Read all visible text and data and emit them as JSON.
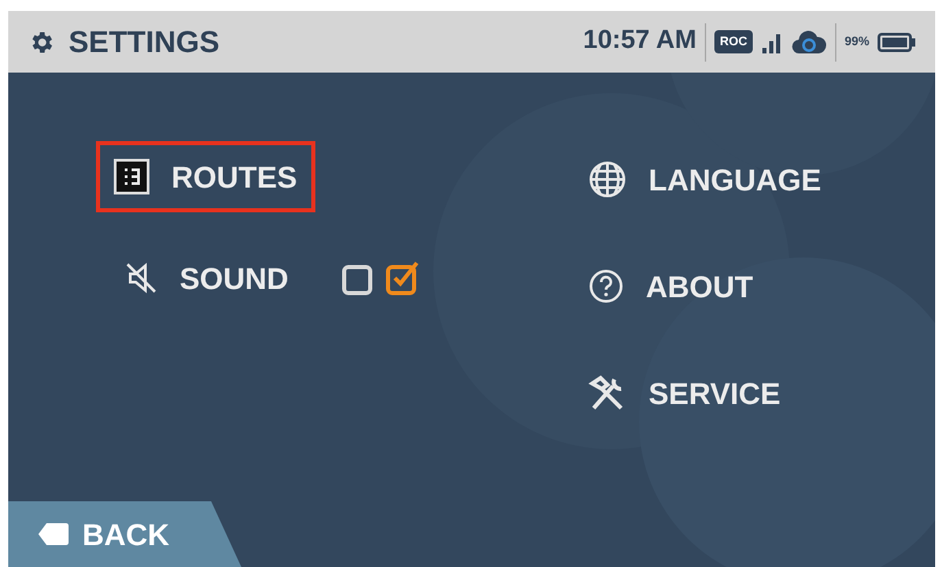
{
  "header": {
    "title": "SETTINGS",
    "time": "10:57 AM",
    "badge": "ROC",
    "battery_text": "99%"
  },
  "left_items": [
    {
      "label": "ROUTES",
      "selected": true
    },
    {
      "label": "SOUND",
      "selected": false,
      "checkboxes": [
        {
          "checked": false
        },
        {
          "checked": true
        }
      ]
    }
  ],
  "right_items": [
    {
      "label": "LANGUAGE",
      "selected": false
    },
    {
      "label": "ABOUT",
      "selected": false
    },
    {
      "label": "SERVICE",
      "selected": false
    }
  ],
  "back_button": {
    "label": "BACK"
  }
}
